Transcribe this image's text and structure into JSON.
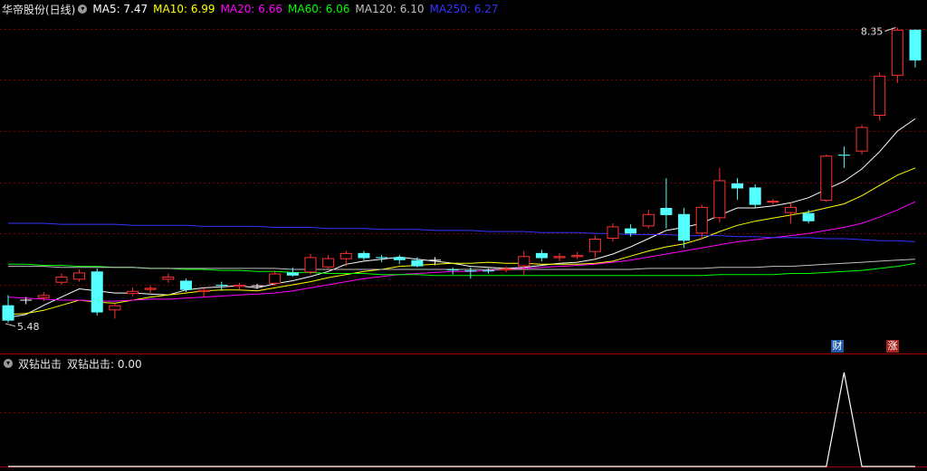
{
  "header": {
    "stock": "华帝股份(日线)",
    "ma": [
      {
        "label": "MA5: 7.47",
        "color": "#ffffff"
      },
      {
        "label": "MA10: 6.99",
        "color": "#ffff00"
      },
      {
        "label": "MA20: 6.66",
        "color": "#ff00ff"
      },
      {
        "label": "MA60: 6.06",
        "color": "#00ff00"
      },
      {
        "label": "MA120: 6.10",
        "color": "#c0c0c0"
      },
      {
        "label": "MA250: 6.27",
        "color": "#3333ff"
      }
    ]
  },
  "sub_header": {
    "name": "双钻出击",
    "value_label": "双钻出击: 0.00"
  },
  "badges": [
    {
      "text": "财",
      "color": "#1e5aa8"
    },
    {
      "text": "涨",
      "color": "#a8211e"
    }
  ],
  "colors": {
    "up": "#ff3232",
    "down": "#54ffff",
    "grid": "#7a0000",
    "doji": "#ffffff"
  },
  "chart_data": [
    {
      "type": "candlestick",
      "annotations": {
        "max_label": "8.35",
        "min_label": "5.48"
      },
      "price_range": [
        5.4,
        8.4
      ],
      "candles": [
        [
          5.65,
          5.5,
          5.75,
          5.48
        ],
        [
          5.7,
          5.7,
          5.73,
          5.66
        ],
        [
          5.72,
          5.75,
          5.78,
          5.69
        ],
        [
          5.87,
          5.93,
          5.96,
          5.85
        ],
        [
          5.9,
          5.97,
          6.0,
          5.88
        ],
        [
          5.98,
          5.58,
          6.01,
          5.55
        ],
        [
          5.6,
          5.65,
          5.67,
          5.52
        ],
        [
          5.76,
          5.79,
          5.82,
          5.74
        ],
        [
          5.8,
          5.82,
          5.84,
          5.77
        ],
        [
          5.9,
          5.93,
          5.96,
          5.87
        ],
        [
          5.89,
          5.8,
          5.91,
          5.78
        ],
        [
          5.78,
          5.8,
          5.82,
          5.73
        ],
        [
          5.85,
          5.84,
          5.88,
          5.79
        ],
        [
          5.83,
          5.85,
          5.87,
          5.8
        ],
        [
          5.84,
          5.84,
          5.86,
          5.81
        ],
        [
          5.86,
          5.96,
          5.99,
          5.84
        ],
        [
          5.97,
          5.94,
          6.02,
          5.93
        ],
        [
          5.97,
          6.12,
          6.15,
          5.95
        ],
        [
          6.02,
          6.11,
          6.14,
          6.0
        ],
        [
          6.1,
          6.16,
          6.18,
          6.03
        ],
        [
          6.16,
          6.11,
          6.18,
          6.09
        ],
        [
          6.12,
          6.11,
          6.14,
          6.07
        ],
        [
          6.12,
          6.09,
          6.14,
          6.05
        ],
        [
          6.09,
          6.03,
          6.12,
          6.02
        ],
        [
          6.09,
          6.09,
          6.12,
          6.04
        ],
        [
          6.0,
          5.99,
          6.02,
          5.95
        ],
        [
          5.99,
          5.98,
          6.02,
          5.91
        ],
        [
          5.99,
          5.98,
          6.01,
          5.96
        ],
        [
          5.99,
          6.01,
          6.03,
          5.97
        ],
        [
          6.03,
          6.13,
          6.18,
          5.95
        ],
        [
          6.16,
          6.11,
          6.19,
          6.08
        ],
        [
          6.11,
          6.13,
          6.16,
          6.08
        ],
        [
          6.12,
          6.14,
          6.17,
          6.1
        ],
        [
          6.17,
          6.3,
          6.33,
          6.11
        ],
        [
          6.3,
          6.42,
          6.45,
          6.27
        ],
        [
          6.4,
          6.35,
          6.44,
          6.32
        ],
        [
          6.42,
          6.54,
          6.58,
          6.4
        ],
        [
          6.6,
          6.53,
          6.89,
          6.4
        ],
        [
          6.54,
          6.28,
          6.6,
          6.21
        ],
        [
          6.35,
          6.61,
          6.63,
          6.3
        ],
        [
          6.5,
          6.87,
          6.99,
          6.46
        ],
        [
          6.84,
          6.79,
          6.89,
          6.68
        ],
        [
          6.8,
          6.63,
          6.83,
          6.6
        ],
        [
          6.66,
          6.67,
          6.69,
          6.63
        ],
        [
          6.55,
          6.61,
          6.65,
          6.45
        ],
        [
          6.55,
          6.47,
          6.58,
          6.45
        ],
        [
          6.67,
          7.11,
          7.12,
          6.66
        ],
        [
          7.12,
          7.11,
          7.2,
          6.99
        ],
        [
          7.15,
          7.39,
          7.41,
          7.12
        ],
        [
          7.5,
          7.89,
          7.92,
          7.45
        ],
        [
          7.89,
          8.34,
          8.36,
          7.82
        ],
        [
          8.34,
          8.04,
          8.34,
          7.97
        ]
      ],
      "ma_series": [
        {
          "name": "MA5",
          "color": "#ffffff",
          "values": [
            5.53,
            5.56,
            5.65,
            5.73,
            5.81,
            5.79,
            5.77,
            5.77,
            5.76,
            5.75,
            5.8,
            5.82,
            5.83,
            5.84,
            5.82,
            5.86,
            5.89,
            5.93,
            5.98,
            6.05,
            6.08,
            6.1,
            6.12,
            6.1,
            6.08,
            6.06,
            6.03,
            6.02,
            6.01,
            6.02,
            6.04,
            6.06,
            6.07,
            6.1,
            6.15,
            6.22,
            6.3,
            6.38,
            6.41,
            6.45,
            6.53,
            6.6,
            6.6,
            6.62,
            6.65,
            6.7,
            6.78,
            6.86,
            6.98,
            7.15,
            7.35,
            7.47
          ]
        },
        {
          "name": "MA10",
          "color": "#ffff00",
          "values": [
            5.56,
            5.57,
            5.6,
            5.65,
            5.7,
            5.68,
            5.67,
            5.7,
            5.73,
            5.75,
            5.77,
            5.79,
            5.8,
            5.8,
            5.79,
            5.82,
            5.85,
            5.88,
            5.92,
            5.95,
            5.98,
            6.0,
            6.03,
            6.04,
            6.05,
            6.06,
            6.06,
            6.07,
            6.06,
            6.06,
            6.05,
            6.05,
            6.05,
            6.06,
            6.08,
            6.13,
            6.18,
            6.22,
            6.25,
            6.3,
            6.37,
            6.43,
            6.47,
            6.5,
            6.53,
            6.56,
            6.6,
            6.64,
            6.72,
            6.82,
            6.92,
            6.99
          ]
        },
        {
          "name": "MA20",
          "color": "#ff00ff",
          "values": [
            5.73,
            5.72,
            5.71,
            5.7,
            5.7,
            5.69,
            5.69,
            5.7,
            5.71,
            5.71,
            5.72,
            5.73,
            5.74,
            5.75,
            5.76,
            5.77,
            5.79,
            5.82,
            5.85,
            5.88,
            5.91,
            5.93,
            5.95,
            5.96,
            5.97,
            5.98,
            5.98,
            5.99,
            6.0,
            6.01,
            6.02,
            6.03,
            6.04,
            6.05,
            6.07,
            6.09,
            6.12,
            6.15,
            6.18,
            6.21,
            6.24,
            6.27,
            6.29,
            6.31,
            6.33,
            6.35,
            6.38,
            6.41,
            6.45,
            6.51,
            6.58,
            6.66
          ]
        },
        {
          "name": "MA60",
          "color": "#00ff00",
          "values": [
            6.05,
            6.05,
            6.04,
            6.04,
            6.03,
            6.03,
            6.02,
            6.02,
            6.01,
            6.01,
            6.0,
            6.0,
            5.99,
            5.99,
            5.98,
            5.98,
            5.97,
            5.97,
            5.96,
            5.96,
            5.96,
            5.95,
            5.95,
            5.95,
            5.94,
            5.94,
            5.94,
            5.94,
            5.94,
            5.94,
            5.94,
            5.94,
            5.94,
            5.94,
            5.94,
            5.94,
            5.94,
            5.94,
            5.94,
            5.94,
            5.95,
            5.95,
            5.95,
            5.95,
            5.96,
            5.96,
            5.97,
            5.98,
            5.99,
            6.01,
            6.03,
            6.06
          ]
        },
        {
          "name": "MA120",
          "color": "#c0c0c0",
          "values": [
            6.03,
            6.03,
            6.03,
            6.02,
            6.02,
            6.02,
            6.02,
            6.02,
            6.01,
            6.01,
            6.01,
            6.01,
            6.01,
            6.01,
            6.01,
            6.01,
            6.0,
            6.0,
            6.0,
            6.0,
            6.0,
            6.0,
            6.0,
            6.0,
            6.0,
            6.0,
            6.0,
            6.0,
            6.0,
            6.0,
            6.0,
            6.0,
            6.0,
            6.0,
            6.0,
            6.0,
            6.01,
            6.01,
            6.01,
            6.01,
            6.02,
            6.02,
            6.02,
            6.03,
            6.03,
            6.04,
            6.05,
            6.06,
            6.07,
            6.08,
            6.09,
            6.1
          ]
        },
        {
          "name": "MA250",
          "color": "#3333ff",
          "values": [
            6.45,
            6.45,
            6.45,
            6.44,
            6.44,
            6.44,
            6.44,
            6.43,
            6.43,
            6.43,
            6.43,
            6.42,
            6.42,
            6.42,
            6.42,
            6.41,
            6.41,
            6.41,
            6.4,
            6.4,
            6.4,
            6.39,
            6.39,
            6.39,
            6.38,
            6.38,
            6.38,
            6.37,
            6.37,
            6.37,
            6.36,
            6.36,
            6.36,
            6.35,
            6.35,
            6.34,
            6.34,
            6.34,
            6.33,
            6.33,
            6.33,
            6.32,
            6.32,
            6.31,
            6.31,
            6.31,
            6.3,
            6.3,
            6.29,
            6.28,
            6.28,
            6.27
          ]
        }
      ]
    },
    {
      "type": "line",
      "name": "双钻出击",
      "color": "#ffffff",
      "values": [
        0,
        0,
        0,
        0,
        0,
        0,
        0,
        0,
        0,
        0,
        0,
        0,
        0,
        0,
        0,
        0,
        0,
        0,
        0,
        0,
        0,
        0,
        0,
        0,
        0,
        0,
        0,
        0,
        0,
        0,
        0,
        0,
        0,
        0,
        0,
        0,
        0,
        0,
        0,
        0,
        0,
        0,
        0,
        0,
        0,
        0,
        0,
        1,
        0,
        0,
        0,
        0
      ],
      "ylim": [
        0,
        1
      ]
    }
  ]
}
